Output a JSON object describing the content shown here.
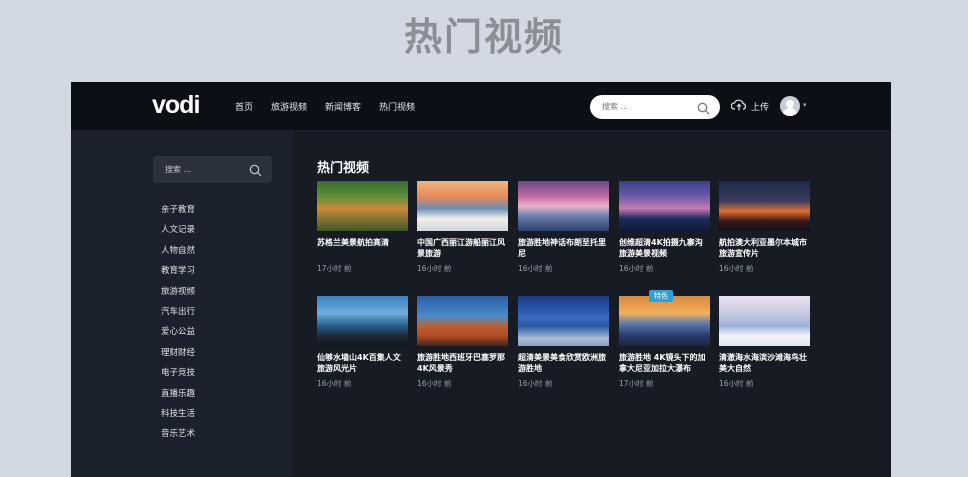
{
  "heading": "热门视频",
  "header": {
    "logo": "vodi",
    "nav": [
      "首页",
      "旅游视频",
      "新闻博客",
      "热门视频"
    ],
    "search_placeholder": "搜索 ...",
    "upload_label": "上传"
  },
  "sidebar": {
    "search_placeholder": "搜索 ...",
    "categories": [
      "亲子教育",
      "人文记录",
      "人物自然",
      "教育学习",
      "旅游视频",
      "汽车出行",
      "爱心公益",
      "理财财经",
      "电子竞技",
      "直播乐趣",
      "科技生活",
      "音乐艺术"
    ]
  },
  "main": {
    "section_title": "热门视频",
    "videos": [
      {
        "title": "苏格兰美景航拍高清",
        "time": "17小时 前"
      },
      {
        "title": "中国广西丽江游船丽江风景旅游",
        "time": "16小时 前"
      },
      {
        "title": "旅游胜地神话布朗至托里尼",
        "time": "16小时 前"
      },
      {
        "title": "创维超清4K拍摄九寨沟旅游美景视频",
        "time": "16小时 前"
      },
      {
        "title": "航拍澳大利亚墨尔本城市旅游宣传片",
        "time": "16小时 前"
      },
      {
        "title": "仙够水墙山4K百集人文旅游风光片",
        "time": "16小时 前"
      },
      {
        "title": "旅游胜地西班牙巴塞罗那4K风景秀",
        "time": "16小时 前"
      },
      {
        "title": "超清美景美食欣赏欧洲旅游胜地",
        "time": "16小时 前"
      },
      {
        "title": "旅游胜地 4K镜头下的加拿大尼亚加拉大瀑布",
        "time": "17小时 前",
        "badge": "特色"
      },
      {
        "title": "清澈海水海滨沙滩海鸟壮美大自然",
        "time": "16小时 前"
      }
    ]
  }
}
